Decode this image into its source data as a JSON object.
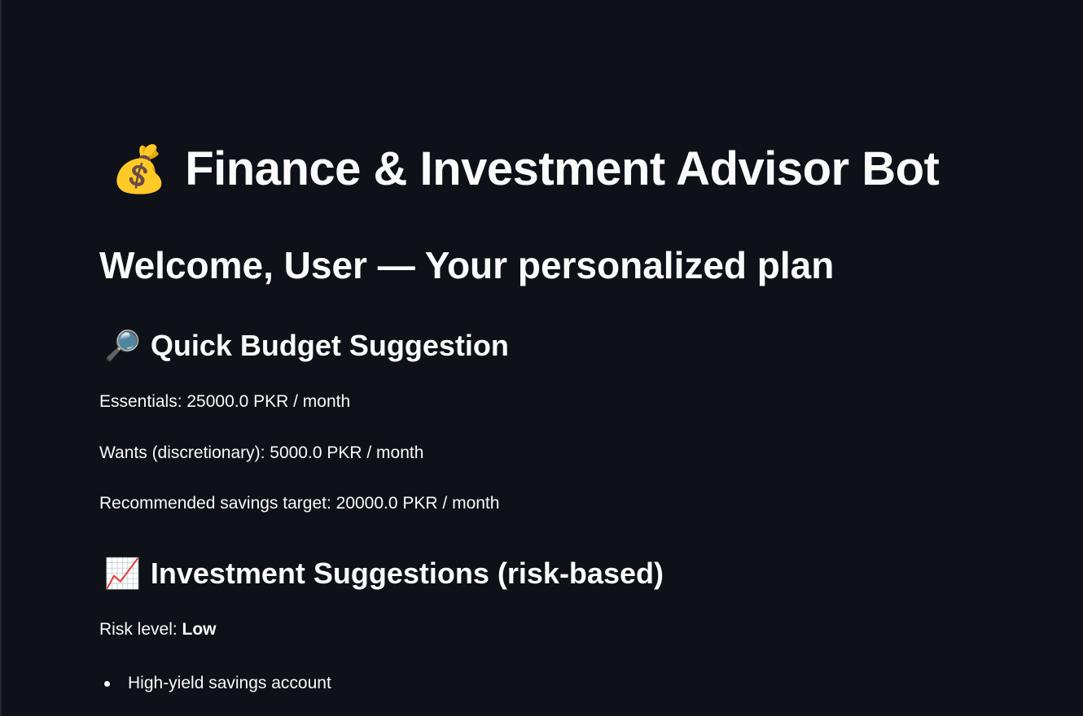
{
  "header": {
    "title_icon": "💰",
    "title_icon_name": "money-bag-icon",
    "title": "Finance & Investment Advisor Bot"
  },
  "welcome": "Welcome, User — Your personalized plan",
  "budget": {
    "icon": "🔎",
    "icon_name": "magnifying-glass-icon",
    "title": "Quick Budget Suggestion",
    "essentials": "Essentials: 25000.0 PKR / month",
    "wants": "Wants (discretionary): 5000.0 PKR / month",
    "savings": "Recommended savings target: 20000.0 PKR / month"
  },
  "investment": {
    "icon": "📈",
    "icon_name": "chart-increasing-icon",
    "title": "Investment Suggestions (risk-based)",
    "risk_label": "Risk level: ",
    "risk_value": "Low",
    "suggestions": [
      "High-yield savings account"
    ]
  },
  "colors": {
    "background": "#0e1117",
    "text": "#fafafa"
  }
}
